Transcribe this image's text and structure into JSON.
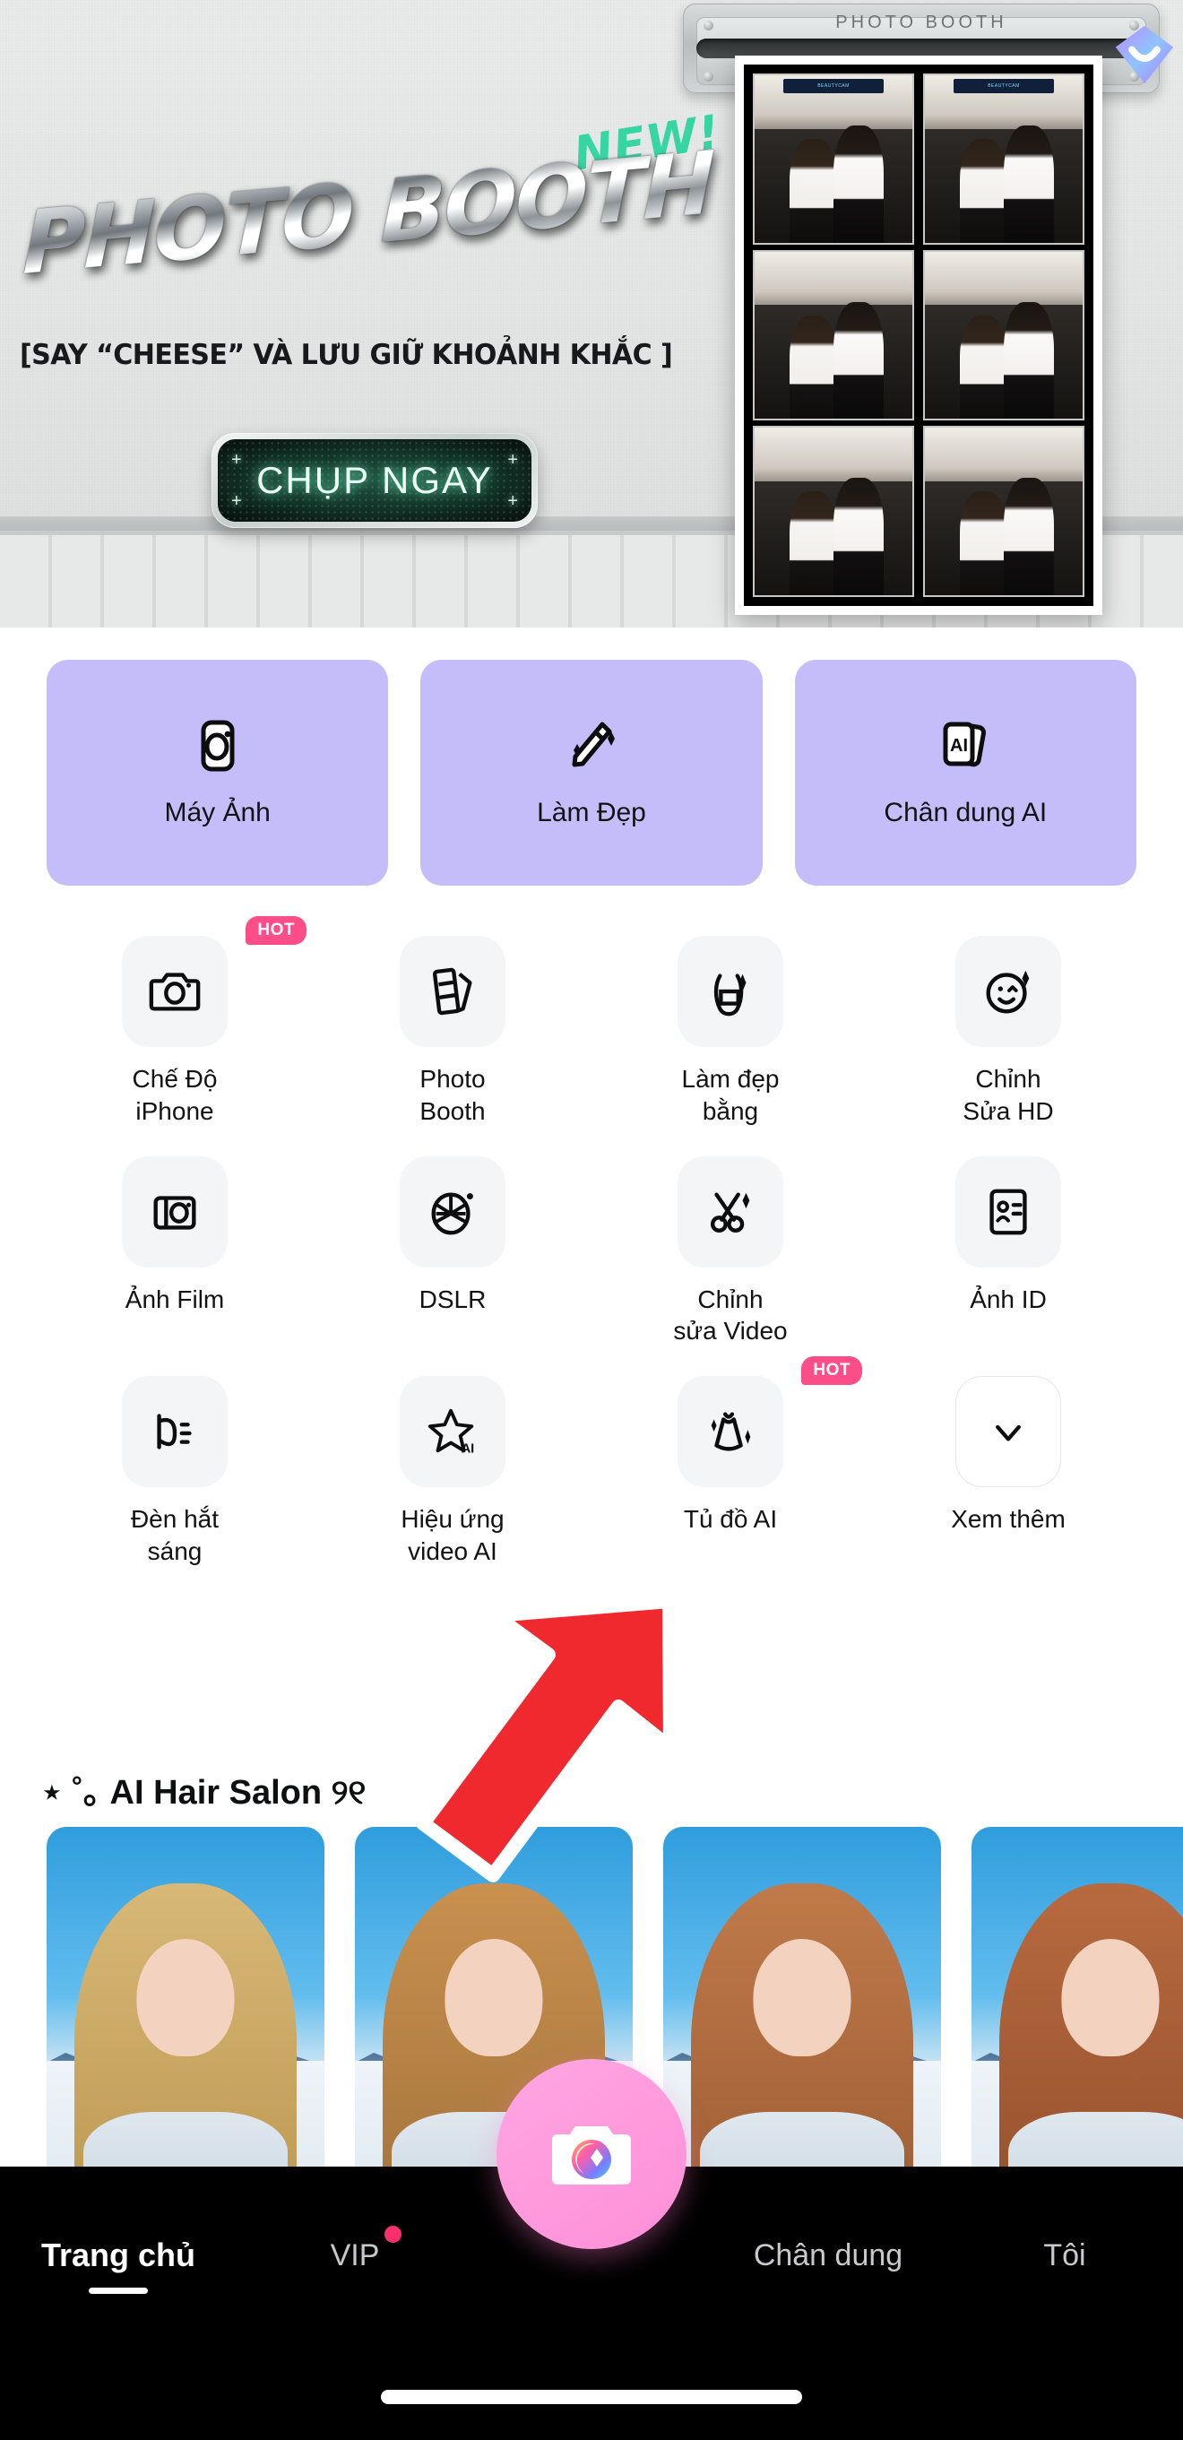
{
  "hero": {
    "new_badge": "NEW!",
    "title": "PHOTO BOOTH",
    "subtitle": "[SAY “CHEESE” VÀ LƯU GIỮ KHOẢNH KHẮC ]",
    "cta_label": "CHỤP NGAY",
    "cta_corner_mark": "+",
    "machine_label": "PHOTO BOOTH",
    "strip_brand": "BEAUTYCAM",
    "smile_badge_icon": "diamond-smile-badge-icon"
  },
  "quick_actions": [
    {
      "label": "Máy Ảnh",
      "icon": "camera-square-icon"
    },
    {
      "label": "Làm Đẹp",
      "icon": "magic-wand-sparkle-icon"
    },
    {
      "label": "Chân dung AI",
      "icon": "ai-cards-icon"
    }
  ],
  "features": [
    {
      "label": "Chế Độ\niPhone",
      "label_line1": "Chế Độ",
      "label_line2": "iPhone",
      "icon": "camera-icon",
      "badge": "HOT"
    },
    {
      "label": "Photo\nBooth",
      "label_line1": "Photo",
      "label_line2": "Booth",
      "icon": "photo-strip-icon",
      "badge": ""
    },
    {
      "label": "Làm đẹp\nbằng",
      "label_line1": "Làm đẹp",
      "label_line2": "bằng",
      "icon": "beauty-body-icon",
      "badge": ""
    },
    {
      "label": "Chỉnh\nSửa HD",
      "label_line1": "Chỉnh",
      "label_line2": "Sửa HD",
      "icon": "smiley-sparkle-icon",
      "badge": ""
    },
    {
      "label": "Ảnh Film",
      "label_line1": "Ảnh Film",
      "label_line2": "",
      "icon": "film-camera-icon",
      "badge": ""
    },
    {
      "label": "DSLR",
      "label_line1": "DSLR",
      "label_line2": "",
      "icon": "aperture-icon",
      "badge": ""
    },
    {
      "label": "Chỉnh\nsửa Video",
      "label_line1": "Chỉnh",
      "label_line2": "sửa Video",
      "icon": "scissors-icon",
      "badge": ""
    },
    {
      "label": "Ảnh ID",
      "label_line1": "Ảnh ID",
      "label_line2": "",
      "icon": "id-card-icon",
      "badge": ""
    },
    {
      "label": "Đèn hắt\nsáng",
      "label_line1": "Đèn hắt",
      "label_line2": "sáng",
      "icon": "studio-light-icon",
      "badge": ""
    },
    {
      "label": "Hiệu ứng\nvideo AI",
      "label_line1": "Hiệu ứng",
      "label_line2": "video AI",
      "icon": "ai-star-video-icon",
      "badge": ""
    },
    {
      "label": "Tủ đồ AI",
      "label_line1": "Tủ đồ AI",
      "label_line2": "",
      "icon": "ai-dress-icon",
      "badge": "HOT"
    },
    {
      "label": "Xem thêm",
      "label_line1": "Xem thêm",
      "label_line2": "",
      "icon": "chevron-down-icon",
      "badge": ""
    }
  ],
  "salon": {
    "title": "⋆ ˚｡ AI Hair Salon ୨୧",
    "cards": [
      {
        "name": "hair-style-blonde",
        "hair": "#d8b877",
        "hair2": "#bb9850"
      },
      {
        "name": "hair-style-golden-brown",
        "hair": "#c9904f",
        "hair2": "#a2733a"
      },
      {
        "name": "hair-style-auburn",
        "hair": "#c07a4a",
        "hair2": "#9c5c33"
      },
      {
        "name": "hair-style-copper",
        "hair": "#b86a3f",
        "hair2": "#93502c"
      }
    ]
  },
  "bottom_nav": {
    "items": [
      {
        "label": "Trang chủ",
        "active": true,
        "dot": false
      },
      {
        "label": "VIP",
        "active": false,
        "dot": true
      },
      {
        "label": "Chân dung",
        "active": false,
        "dot": false
      },
      {
        "label": "Tôi",
        "active": false,
        "dot": false
      }
    ],
    "center_icon": "camera-shutter-icon"
  },
  "colors": {
    "accent_purple": "#c4bdfa",
    "hot_pink": "#fb4d88",
    "nav_pink": "#ff8fd8",
    "new_green": "#36d5a1",
    "arrow_red": "#f0292f"
  }
}
